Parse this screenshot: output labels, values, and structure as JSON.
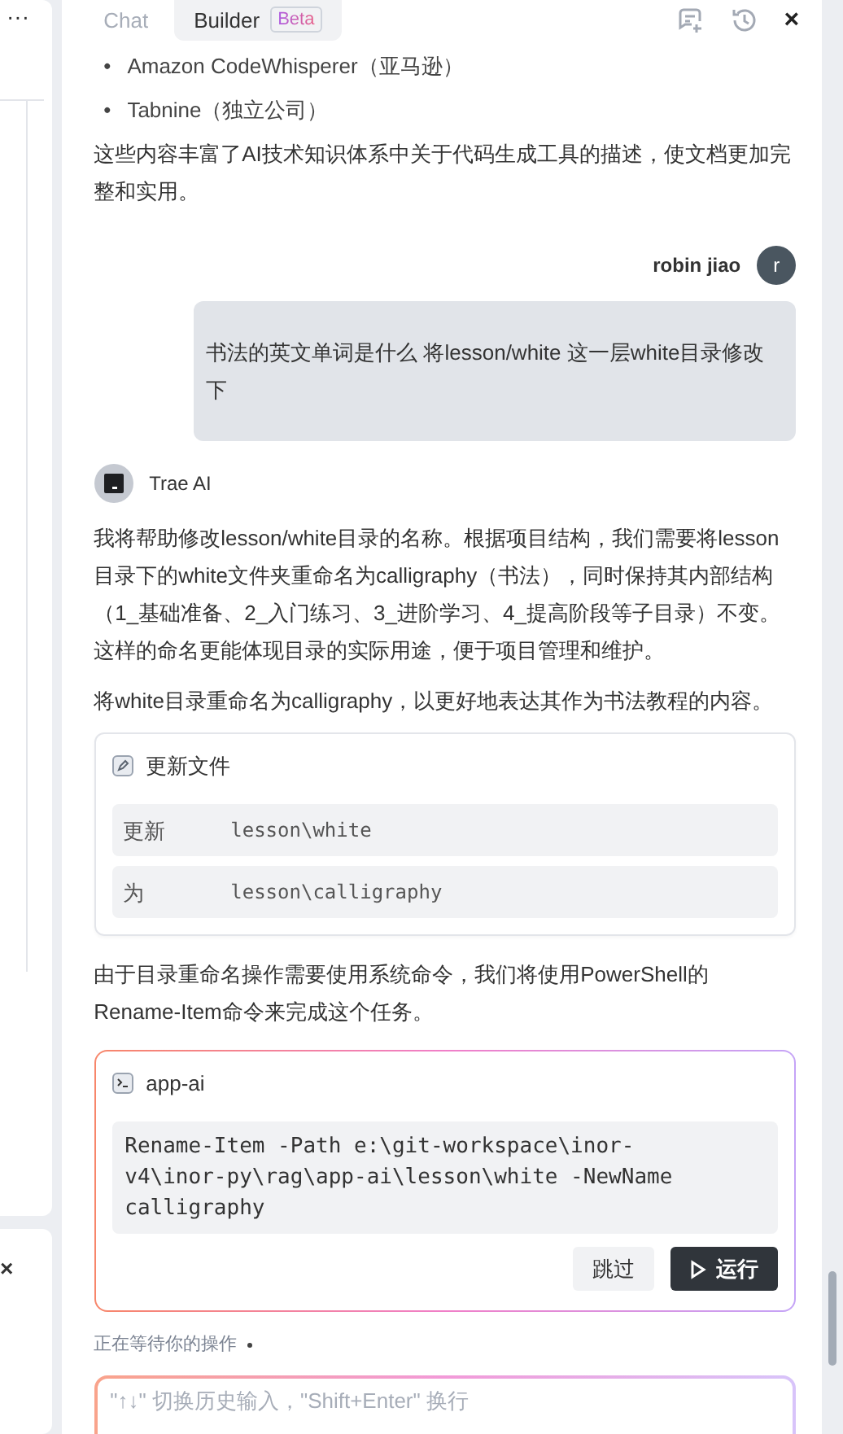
{
  "left_strip": {
    "menu": "···",
    "close": "×"
  },
  "header": {
    "tabs": [
      {
        "label": "Chat",
        "selected": false
      },
      {
        "label": "Builder",
        "selected": true,
        "badge": "Beta"
      }
    ],
    "close": "×"
  },
  "messages": [
    {
      "kind": "ai_tail",
      "bullet_mark": "•",
      "bullets": [
        "Amazon CodeWhisperer（亚马逊）",
        "Tabnine（独立公司）"
      ],
      "paragraphs": [
        "这些内容丰富了AI技术知识体系中关于代码生成工具的描述，使文档更加完整和实用。"
      ]
    },
    {
      "kind": "user",
      "author": "robin jiao",
      "avatar": "r",
      "text": "书法的英文单词是什么 将lesson/white 这一层white目录修改下"
    },
    {
      "kind": "ai",
      "author": "Trae AI",
      "paragraphs": [
        "我将帮助修改lesson/white目录的名称。根据项目结构，我们需要将lesson目录下的white文件夹重命名为calligraphy（书法），同时保持其内部结构（1_基础准备、2_入门练习、3_进阶学习、4_提高阶段等子目录）不变。这样的命名更能体现目录的实际用途，便于项目管理和维护。",
        "将white目录重命名为calligraphy，以更好地表达其作为书法教程的内容。"
      ],
      "file_card": {
        "title": "更新文件",
        "rows": [
          {
            "label": "更新",
            "path": "lesson\\white"
          },
          {
            "label": "为",
            "path": "lesson\\calligraphy"
          }
        ]
      },
      "after": [
        "由于目录重命名操作需要使用系统命令，我们将使用PowerShell的Rename-Item命令来完成这个任务。"
      ],
      "command_card": {
        "title": "app-ai",
        "command": "Rename-Item -Path e:\\git-workspace\\inor-v4\\inor-py\\rag\\app-ai\\lesson\\white -NewName calligraphy",
        "skip": "跳过",
        "run": "运行"
      }
    }
  ],
  "status": "正在等待你的操作",
  "input": {
    "placeholder": "\"↑↓\" 切换历史输入，\"Shift+Enter\" 换行"
  }
}
